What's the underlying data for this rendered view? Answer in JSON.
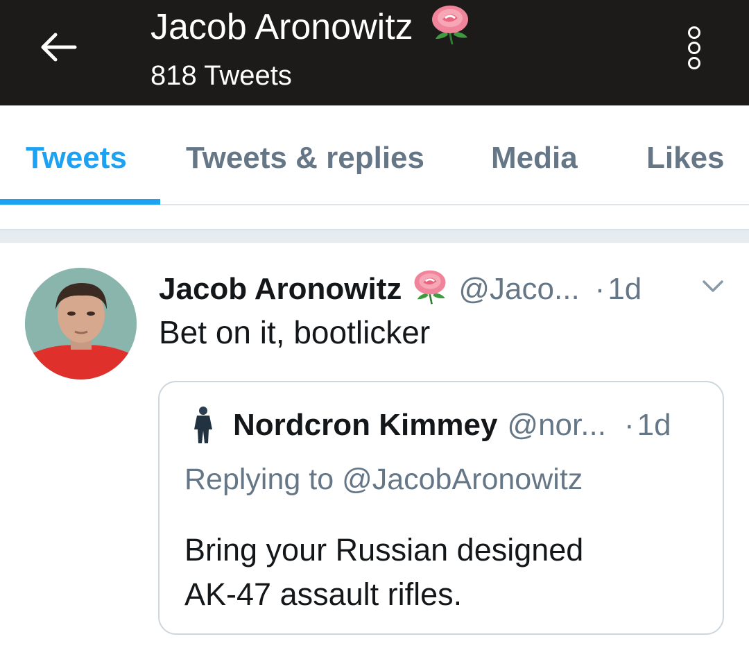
{
  "header": {
    "title": "Jacob Aronowitz",
    "subtitle": "818 Tweets",
    "back_icon": "arrow-left-icon",
    "name_emoji": "rose-icon",
    "menu_icon": "vertical-ellipsis-icon"
  },
  "tabs": [
    {
      "label": "Tweets",
      "active": true
    },
    {
      "label": "Tweets & replies",
      "active": false
    },
    {
      "label": "Media",
      "active": false
    },
    {
      "label": "Likes",
      "active": false
    }
  ],
  "tweet": {
    "author": "Jacob Aronowitz",
    "handle": "@Jaco...",
    "dot": "·",
    "time": "1d",
    "text": "Bet on it, bootlicker",
    "caret_icon": "chevron-down-icon",
    "quote": {
      "author": "Nordcron Kimmey",
      "handle": "@nor...",
      "dot": "·",
      "time": "1d",
      "replying_prefix": "Replying to ",
      "replying_to": "@JacobAronowitz",
      "text_line1": "Bring your Russian designed",
      "text_line2": "AK-47 assault rifles."
    }
  },
  "colors": {
    "header_bg": "#1c1b19",
    "accent": "#1da1f2",
    "muted": "#657786",
    "text": "#14171a",
    "separator": "#e6ecf0"
  }
}
